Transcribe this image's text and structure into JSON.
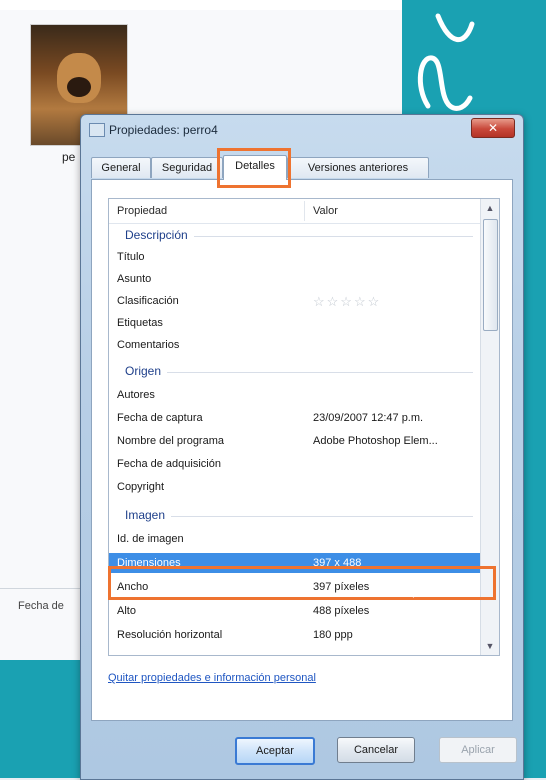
{
  "background": {
    "thumbnail_caption": "pe",
    "field_label": "Fecha de"
  },
  "dialog": {
    "title": "Propiedades: perro4",
    "close_label": "✕",
    "tabs": [
      "General",
      "Seguridad",
      "Detalles",
      "Versiones anteriores"
    ],
    "active_tab": "Detalles",
    "columns": {
      "property": "Propiedad",
      "value": "Valor"
    },
    "groups": {
      "descripcion": "Descripción",
      "origen": "Origen",
      "imagen": "Imagen"
    },
    "rows": [
      {
        "name": "Título",
        "value": ""
      },
      {
        "name": "Asunto",
        "value": ""
      },
      {
        "name": "Clasificación",
        "value": "☆☆☆☆☆"
      },
      {
        "name": "Etiquetas",
        "value": ""
      },
      {
        "name": "Comentarios",
        "value": ""
      },
      {
        "name": "Autores",
        "value": ""
      },
      {
        "name": "Fecha de captura",
        "value": "23/09/2007 12:47 p.m."
      },
      {
        "name": "Nombre del programa",
        "value": "Adobe Photoshop Elem..."
      },
      {
        "name": "Fecha de adquisición",
        "value": ""
      },
      {
        "name": "Copyright",
        "value": ""
      },
      {
        "name": "Id. de imagen",
        "value": ""
      },
      {
        "name": "Dimensiones",
        "value": "397 x 488"
      },
      {
        "name": "Ancho",
        "value": "397 píxeles"
      },
      {
        "name": "Alto",
        "value": "488 píxeles"
      },
      {
        "name": "Resolución horizontal",
        "value": "180 ppp"
      }
    ],
    "link": "Quitar propiedades e información personal",
    "buttons": {
      "ok": "Aceptar",
      "cancel": "Cancelar",
      "apply": "Aplicar"
    },
    "selected_row": "Dimensiones",
    "accent_color": "#ee7330",
    "selection_color": "#3d8ee6"
  }
}
